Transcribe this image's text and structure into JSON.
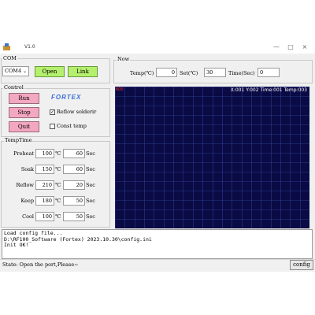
{
  "window": {
    "title": "V1.0",
    "controls": [
      "—",
      "□",
      "×"
    ]
  },
  "com": {
    "group_title": "COM",
    "port_value": "COM4",
    "open_label": "Open",
    "link_label": "Link"
  },
  "now": {
    "group_title": "Now",
    "temp_label": "Temp(℃)",
    "temp_value": "0",
    "set_label": "Set(℃)",
    "set_value": "30",
    "time_label": "Time(Sec)",
    "time_value": "0"
  },
  "control": {
    "group_title": "Control",
    "run_label": "Run",
    "stop_label": "Stop",
    "quit_label": "Quit",
    "brand": "FORTEX",
    "reflow_label": "Reflow solderir",
    "reflow_checked": true,
    "const_label": "Const temp",
    "const_checked": false
  },
  "temptime": {
    "group_title": "TempTime",
    "temp_unit": "℃",
    "time_unit": "Sec",
    "rows": [
      {
        "name": "Preheat",
        "temp": "100",
        "time": "60"
      },
      {
        "name": "Soak",
        "temp": "150",
        "time": "60"
      },
      {
        "name": "Reflow",
        "temp": "210",
        "time": "20"
      },
      {
        "name": "Keep",
        "temp": "180",
        "time": "50"
      },
      {
        "name": "Cool",
        "temp": "100",
        "time": "50"
      }
    ]
  },
  "chart": {
    "corner_label": "600",
    "readout": "X:001 Y:002 Time:001 Temp:003",
    "background": "#0a0a45",
    "grid_color": "#2a3a8a",
    "corner_color": "#ff3030"
  },
  "log": {
    "lines": [
      "Load config file...",
      "D:\\RF100_Software (Fortex) 2023.10.30\\config.ini",
      "Init OK!"
    ]
  },
  "status": {
    "text": "State: Open the port,Please~",
    "config_label": "config"
  }
}
